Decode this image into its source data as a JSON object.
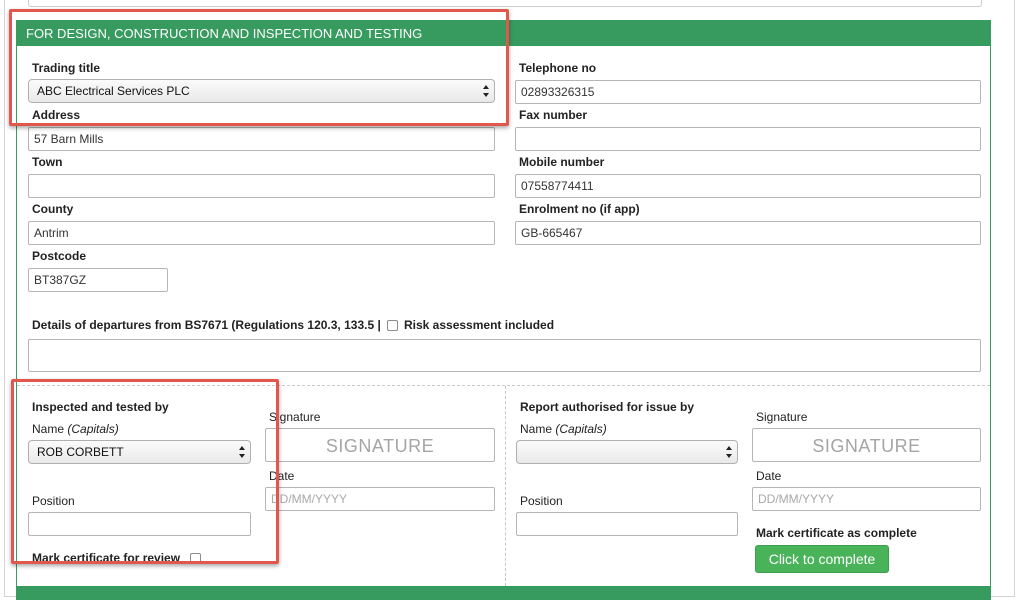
{
  "section": {
    "title": "FOR DESIGN, CONSTRUCTION AND INSPECTION AND TESTING",
    "accent_color": "#379a5f"
  },
  "contractor": {
    "trading_title_label": "Trading title",
    "trading_title_value": "ABC Electrical Services PLC",
    "telephone_label": "Telephone no",
    "telephone_value": "02893326315",
    "address_label": "Address",
    "address_value": "57 Barn Mills",
    "fax_label": "Fax number",
    "fax_value": "",
    "town_label": "Town",
    "town_value": "",
    "mobile_label": "Mobile number",
    "mobile_value": "07558774411",
    "county_label": "County",
    "county_value": "Antrim",
    "enrolment_label": "Enrolment no (if app)",
    "enrolment_value": "GB-665467",
    "postcode_label": "Postcode",
    "postcode_value": "BT387GZ"
  },
  "departures": {
    "label": "Details of departures from BS7671 (Regulations 120.3, 133.5 |",
    "risk_assessment_label": "Risk assessment included",
    "value": ""
  },
  "inspected": {
    "heading": "Inspected and tested by",
    "name_label": "Name",
    "name_hint": "(Capitals)",
    "name_value": "ROB CORBETT",
    "signature_label": "Signature",
    "signature_placeholder": "SIGNATURE",
    "date_label": "Date",
    "date_placeholder": "DD/MM/YYYY",
    "position_label": "Position",
    "position_value": "",
    "review_label": "Mark certificate for review"
  },
  "authorised": {
    "heading": "Report authorised for issue by",
    "name_label": "Name",
    "name_hint": "(Capitals)",
    "name_value": "",
    "signature_label": "Signature",
    "signature_placeholder": "SIGNATURE",
    "date_label": "Date",
    "date_placeholder": "DD/MM/YYYY",
    "position_label": "Position",
    "position_value": "",
    "complete_label": "Mark certificate as complete",
    "complete_button": "Click to complete",
    "button_color": "#49b35a"
  },
  "annotations": {
    "highlight_color": "#e0584d"
  }
}
